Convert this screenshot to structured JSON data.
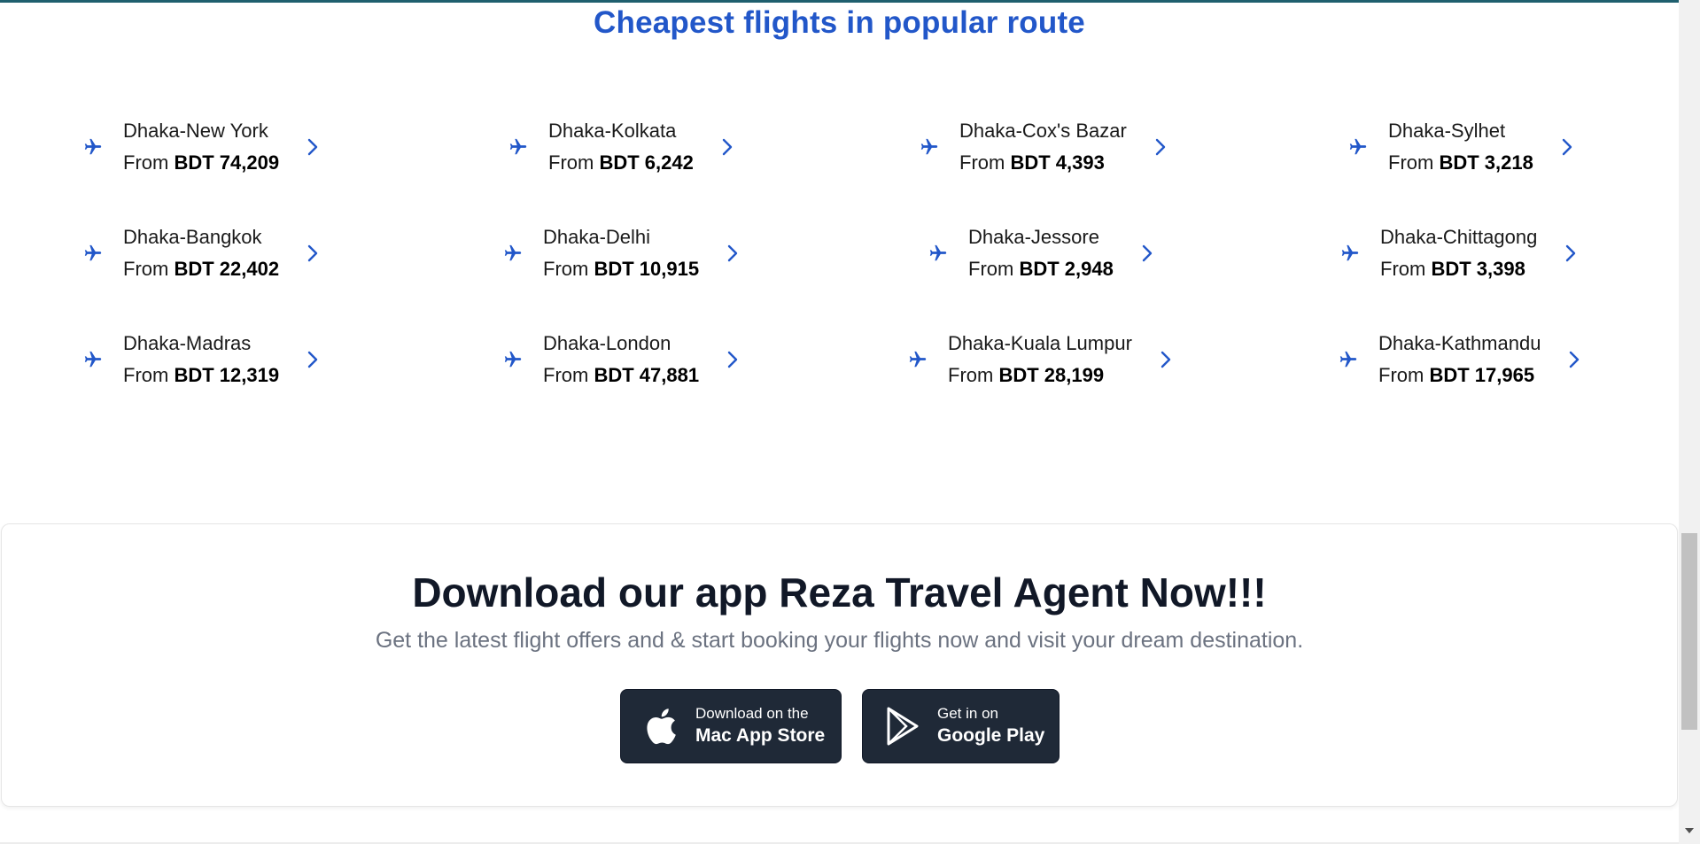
{
  "section": {
    "title": "Cheapest flights in popular route"
  },
  "routes": [
    {
      "name": "Dhaka-New York",
      "prefix": "From ",
      "price": "BDT 74,209"
    },
    {
      "name": "Dhaka-Kolkata",
      "prefix": "From ",
      "price": "BDT 6,242"
    },
    {
      "name": "Dhaka-Cox's Bazar",
      "prefix": "From ",
      "price": "BDT 4,393"
    },
    {
      "name": "Dhaka-Sylhet",
      "prefix": "From ",
      "price": "BDT 3,218"
    },
    {
      "name": "Dhaka-Bangkok",
      "prefix": "From ",
      "price": "BDT 22,402"
    },
    {
      "name": "Dhaka-Delhi",
      "prefix": "From ",
      "price": "BDT 10,915"
    },
    {
      "name": "Dhaka-Jessore",
      "prefix": "From ",
      "price": "BDT 2,948"
    },
    {
      "name": "Dhaka-Chittagong",
      "prefix": "From ",
      "price": "BDT 3,398"
    },
    {
      "name": "Dhaka-Madras",
      "prefix": "From ",
      "price": "BDT 12,319"
    },
    {
      "name": "Dhaka-London",
      "prefix": "From ",
      "price": "BDT 47,881"
    },
    {
      "name": "Dhaka-Kuala Lumpur",
      "prefix": "From ",
      "price": "BDT 28,199"
    },
    {
      "name": "Dhaka-Kathmandu",
      "prefix": "From ",
      "price": "BDT 17,965"
    }
  ],
  "app": {
    "heading": "Download our app Reza Travel Agent Now!!!",
    "subtitle": "Get the latest flight offers and & start booking your flights now and visit your dream destination.",
    "apple": {
      "small": "Download on the",
      "big": "Mac App Store",
      "icon": "apple-icon"
    },
    "google": {
      "small": "Get in on",
      "big": "Google Play",
      "icon": "google-play-icon"
    }
  },
  "colors": {
    "accent": "#2257c9",
    "heading": "#111827",
    "muted": "#6b7280",
    "button_bg": "#1f2937"
  },
  "icons": {
    "route": "airplane-icon",
    "route_arrow": "chevron-right-icon"
  }
}
